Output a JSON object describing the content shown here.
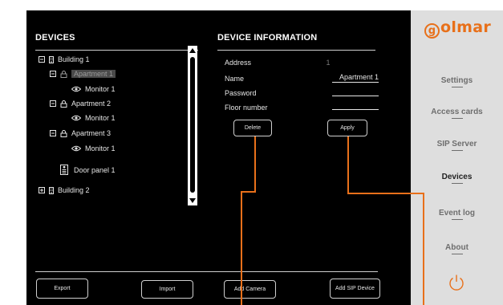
{
  "devices_panel": {
    "title": "DEVICES",
    "tree": [
      {
        "toggle": "−",
        "icon": "building",
        "label": "Building 1"
      },
      {
        "toggle": "−",
        "icon": "apartment",
        "label": "Apartment 1",
        "selected": true
      },
      {
        "toggle": "",
        "icon": "monitor",
        "label": "Monitor 1"
      },
      {
        "toggle": "−",
        "icon": "apartment",
        "label": "Apartment 2"
      },
      {
        "toggle": "",
        "icon": "monitor",
        "label": "Monitor 1"
      },
      {
        "toggle": "−",
        "icon": "apartment",
        "label": "Apartment 3"
      },
      {
        "toggle": "",
        "icon": "monitor",
        "label": "Monitor 1"
      },
      {
        "toggle": "",
        "icon": "door-panel",
        "label": "Door panel 1"
      },
      {
        "toggle": "+",
        "icon": "building",
        "label": "Building 2"
      }
    ]
  },
  "device_info": {
    "title": "DEVICE INFORMATION",
    "address_label": "Address",
    "address_value": "1",
    "name_label": "Name",
    "name_value": "Apartment 1",
    "password_label": "Password",
    "password_value": "",
    "floor_label": "Floor number",
    "floor_value": "",
    "delete_label": "Delete",
    "apply_label": "Apply"
  },
  "bottom_bar": {
    "export_label": "Export",
    "import_label": "Import",
    "add_camera_label": "Add Camera",
    "add_sip_label": "Add SIP Device"
  },
  "sidebar": {
    "logo": "olmar",
    "logo_initial": "g",
    "items": [
      "Settings",
      "Access cards",
      "SIP Server",
      "Devices",
      "Event log",
      "About"
    ],
    "active": "Devices"
  },
  "colors": {
    "accent": "#e8701a",
    "main_bg": "#000000",
    "sidebar_bg": "#dedede"
  }
}
